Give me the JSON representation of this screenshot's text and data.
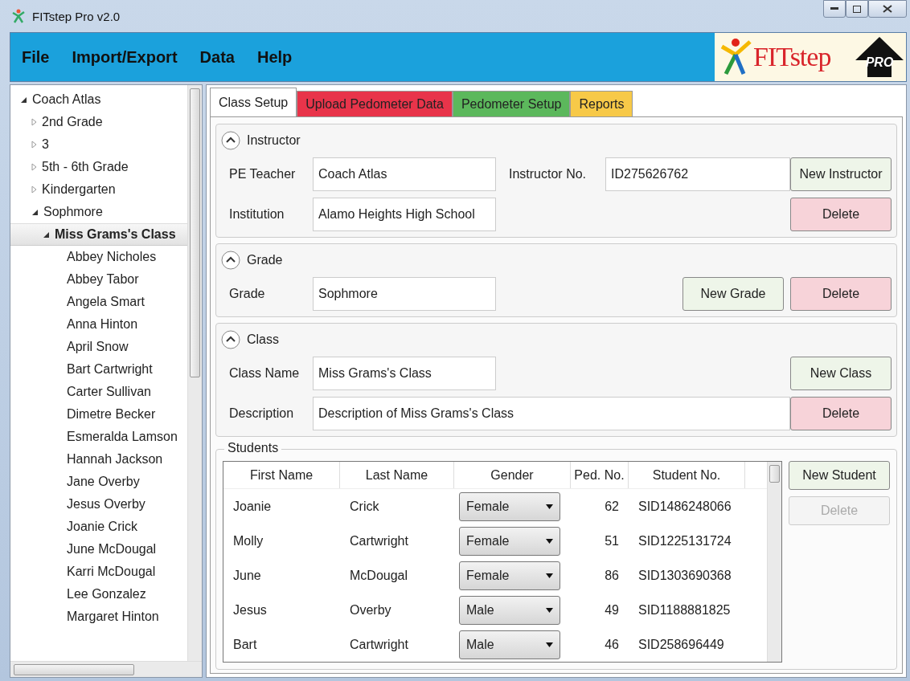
{
  "window": {
    "title": "FITstep Pro v2.0"
  },
  "menu": [
    "File",
    "Import/Export",
    "Data",
    "Help"
  ],
  "logo": {
    "name": "FITstep",
    "badge": "PRO"
  },
  "tree": [
    {
      "label": "Coach Atlas",
      "expanded": true,
      "selected": false,
      "children": [
        {
          "label": "2nd Grade",
          "expanded": false,
          "selected": false
        },
        {
          "label": "3",
          "expanded": false,
          "selected": false
        },
        {
          "label": "5th - 6th Grade",
          "expanded": false,
          "selected": false
        },
        {
          "label": "Kindergarten",
          "expanded": false,
          "selected": false
        },
        {
          "label": "Sophmore",
          "expanded": true,
          "selected": false,
          "children": [
            {
              "label": "Miss Grams's Class",
              "expanded": true,
              "selected": true,
              "children": [
                {
                  "label": "Abbey Nicholes",
                  "selected": false
                },
                {
                  "label": "Abbey Tabor",
                  "selected": false
                },
                {
                  "label": "Angela Smart",
                  "selected": false
                },
                {
                  "label": "Anna Hinton",
                  "selected": false
                },
                {
                  "label": "April Snow",
                  "selected": false
                },
                {
                  "label": "Bart Cartwright",
                  "selected": false
                },
                {
                  "label": "Carter Sullivan",
                  "selected": false
                },
                {
                  "label": "Dimetre Becker",
                  "selected": false
                },
                {
                  "label": "Esmeralda Lamson",
                  "selected": false
                },
                {
                  "label": "Hannah Jackson",
                  "selected": false
                },
                {
                  "label": "Jane Overby",
                  "selected": false
                },
                {
                  "label": "Jesus Overby",
                  "selected": false
                },
                {
                  "label": "Joanie Crick",
                  "selected": false
                },
                {
                  "label": "June McDougal",
                  "selected": false
                },
                {
                  "label": "Karri McDougal",
                  "selected": false
                },
                {
                  "label": "Lee Gonzalez",
                  "selected": false
                },
                {
                  "label": "Margaret Hinton",
                  "selected": false
                }
              ]
            }
          ]
        }
      ]
    }
  ],
  "tabs": [
    {
      "label": "Class Setup",
      "selected": true,
      "color": "#ffffff"
    },
    {
      "label": "Upload Pedometer Data",
      "selected": false,
      "color": "#e8344a"
    },
    {
      "label": "Pedometer Setup",
      "selected": false,
      "color": "#5cb85c"
    },
    {
      "label": "Reports",
      "selected": false,
      "color": "#f7c948"
    }
  ],
  "sections": [
    {
      "title": "Instructor",
      "expanded": true,
      "rows": [
        {
          "fields": [
            {
              "label": "PE Teacher",
              "value": "Coach Atlas"
            },
            {
              "label": "Instructor No.",
              "value": "ID275626762"
            }
          ],
          "button": {
            "label": "New Instructor",
            "kind": "normal",
            "disabled": false
          }
        },
        {
          "fields": [
            {
              "label": "Institution",
              "value": "Alamo Heights High School"
            }
          ],
          "button": {
            "label": "Delete",
            "kind": "danger",
            "disabled": false
          }
        }
      ]
    },
    {
      "title": "Grade",
      "expanded": true,
      "rows": [
        {
          "fields": [
            {
              "label": "Grade",
              "value": "Sophmore"
            }
          ],
          "buttons": [
            {
              "label": "New Grade",
              "kind": "normal",
              "disabled": false
            },
            {
              "label": "Delete",
              "kind": "danger",
              "disabled": false
            }
          ]
        }
      ]
    },
    {
      "title": "Class",
      "expanded": true,
      "rows": [
        {
          "fields": [
            {
              "label": "Class Name",
              "value": "Miss Grams's Class"
            }
          ],
          "button": {
            "label": "New Class",
            "kind": "normal",
            "disabled": false
          }
        },
        {
          "fields": [
            {
              "label": "Description",
              "value": "Description of Miss Grams's Class"
            }
          ],
          "button": {
            "label": "Delete",
            "kind": "danger",
            "disabled": false
          }
        }
      ]
    }
  ],
  "students": {
    "title": "Students",
    "columns": [
      "First Name",
      "Last Name",
      "Gender",
      "Ped. No.",
      "Student No."
    ],
    "rows": [
      {
        "first": "Joanie",
        "last": "Crick",
        "gender": "Female",
        "ped": "62",
        "sid": "SID1486248066"
      },
      {
        "first": "Molly",
        "last": "Cartwright",
        "gender": "Female",
        "ped": "51",
        "sid": "SID1225131724"
      },
      {
        "first": "June",
        "last": "McDougal",
        "gender": "Female",
        "ped": "86",
        "sid": "SID1303690368"
      },
      {
        "first": "Jesus",
        "last": "Overby",
        "gender": "Male",
        "ped": "49",
        "sid": "SID1188881825"
      },
      {
        "first": "Bart",
        "last": "Cartwright",
        "gender": "Male",
        "ped": "46",
        "sid": "SID258696449"
      }
    ],
    "buttons": [
      {
        "label": "New Student",
        "kind": "normal",
        "disabled": false
      },
      {
        "label": "Delete",
        "kind": "normal",
        "disabled": true
      }
    ]
  }
}
